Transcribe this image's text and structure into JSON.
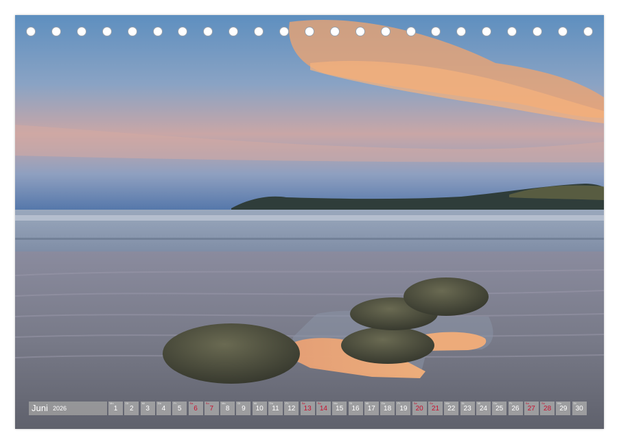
{
  "calendar": {
    "month": "Juni",
    "year": "2026",
    "days": [
      {
        "wd": "Mo",
        "n": "1",
        "hl": false
      },
      {
        "wd": "Di",
        "n": "2",
        "hl": false
      },
      {
        "wd": "Mi",
        "n": "3",
        "hl": false
      },
      {
        "wd": "Do",
        "n": "4",
        "hl": false
      },
      {
        "wd": "Fr",
        "n": "5",
        "hl": false
      },
      {
        "wd": "Sa",
        "n": "6",
        "hl": true
      },
      {
        "wd": "So",
        "n": "7",
        "hl": true
      },
      {
        "wd": "Mo",
        "n": "8",
        "hl": false
      },
      {
        "wd": "Di",
        "n": "9",
        "hl": false
      },
      {
        "wd": "Mi",
        "n": "10",
        "hl": false
      },
      {
        "wd": "Do",
        "n": "11",
        "hl": false
      },
      {
        "wd": "Fr",
        "n": "12",
        "hl": false
      },
      {
        "wd": "Sa",
        "n": "13",
        "hl": true
      },
      {
        "wd": "So",
        "n": "14",
        "hl": true
      },
      {
        "wd": "Mo",
        "n": "15",
        "hl": false
      },
      {
        "wd": "Di",
        "n": "16",
        "hl": false
      },
      {
        "wd": "Mi",
        "n": "17",
        "hl": false
      },
      {
        "wd": "Do",
        "n": "18",
        "hl": false
      },
      {
        "wd": "Fr",
        "n": "19",
        "hl": false
      },
      {
        "wd": "Sa",
        "n": "20",
        "hl": true
      },
      {
        "wd": "So",
        "n": "21",
        "hl": true
      },
      {
        "wd": "Mo",
        "n": "22",
        "hl": false
      },
      {
        "wd": "Di",
        "n": "23",
        "hl": false
      },
      {
        "wd": "Mi",
        "n": "24",
        "hl": false
      },
      {
        "wd": "Do",
        "n": "25",
        "hl": false
      },
      {
        "wd": "Fr",
        "n": "26",
        "hl": false
      },
      {
        "wd": "Sa",
        "n": "27",
        "hl": true
      },
      {
        "wd": "So",
        "n": "28",
        "hl": true
      },
      {
        "wd": "Mo",
        "n": "29",
        "hl": false
      },
      {
        "wd": "Di",
        "n": "30",
        "hl": false
      }
    ]
  },
  "colors": {
    "weekend": "#c8102e",
    "sky_top": "#5f8fbf",
    "cloud": "#f4a46a",
    "sand": "#7d7f8c"
  }
}
